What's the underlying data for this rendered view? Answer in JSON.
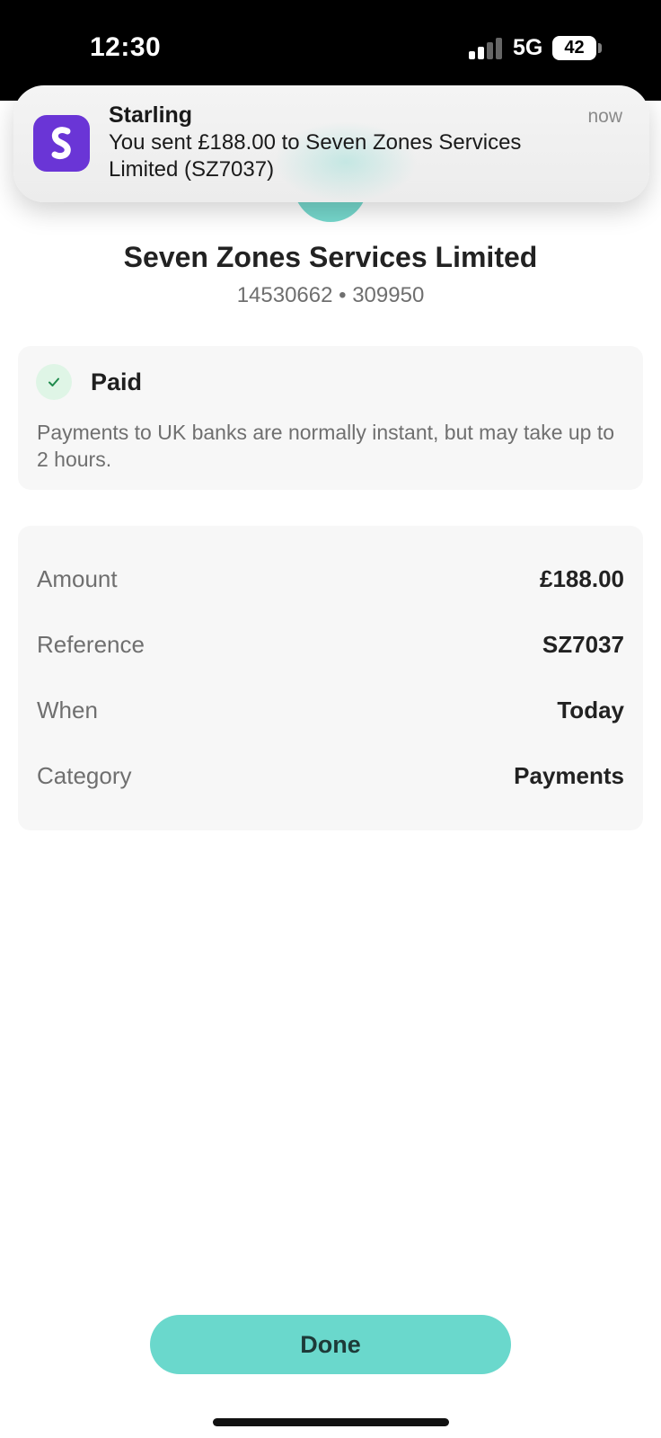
{
  "status_bar": {
    "time": "12:30",
    "network": "5G",
    "battery": "42"
  },
  "notification": {
    "app_name": "Starling",
    "time": "now",
    "message": "You sent £188.00 to Seven Zones Services Limited (SZ7037)",
    "icon": "starling-logo-icon",
    "icon_color": "#6a35d6"
  },
  "recipient": {
    "name": "Seven Zones Services Limited",
    "account": "14530662 • 309950"
  },
  "status_card": {
    "title": "Paid",
    "description": "Payments to UK banks are normally instant, but may take up to 2 hours.",
    "icon": "check-icon"
  },
  "details": [
    {
      "label": "Amount",
      "value": "£188.00"
    },
    {
      "label": "Reference",
      "value": "SZ7037"
    },
    {
      "label": "When",
      "value": "Today"
    },
    {
      "label": "Category",
      "value": "Payments"
    }
  ],
  "actions": {
    "done_label": "Done"
  },
  "colors": {
    "accent": "#6ad8cc",
    "success": "#1f8a4c",
    "brand": "#6a35d6"
  }
}
